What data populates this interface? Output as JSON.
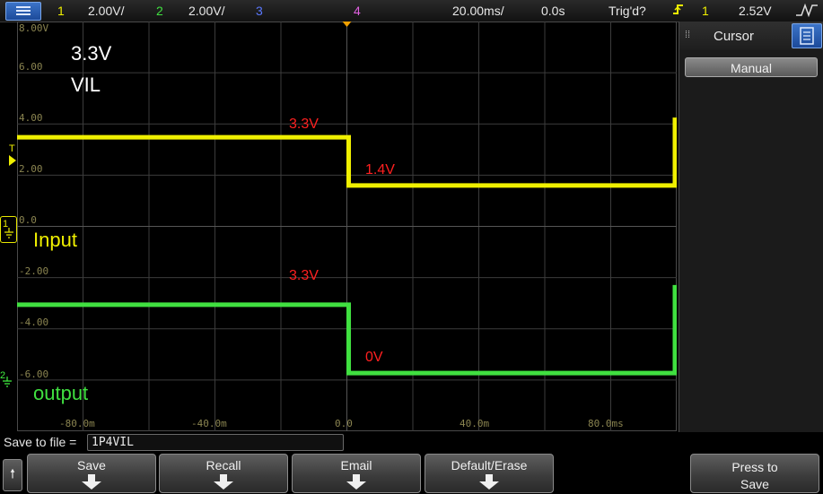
{
  "status_bar": {
    "ch1_label": "1",
    "ch1_scale": "2.00V/",
    "ch2_label": "2",
    "ch2_scale": "2.00V/",
    "ch3_label": "3",
    "ch4_label": "4",
    "timebase": "20.00ms/",
    "delay": "0.0s",
    "trigger_state": "Trig'd?",
    "trigger_source": "1",
    "trigger_level": "2.52V",
    "colors": {
      "ch1": "#f0f000",
      "ch2": "#40e040",
      "ch3": "#5a78ff",
      "ch4": "#e060e0",
      "menu": "#2a60b8"
    }
  },
  "graticule": {
    "y_labels": [
      "8.00V",
      "6.00",
      "4.00",
      "2.00",
      "0.0",
      "-2.00",
      "-4.00",
      "-6.00"
    ],
    "x_labels": [
      "-80.0m",
      "-40.0m",
      "0.0",
      "40.0m",
      "80.0ms"
    ]
  },
  "annotations": {
    "title_line1": "3.3V",
    "title_line2": "VIL",
    "input_label": "Input",
    "output_label": "output",
    "ch1_high": "3.3V",
    "ch1_low": "1.4V",
    "ch2_high": "3.3V",
    "ch2_low": "0V"
  },
  "waveforms": {
    "ch1": {
      "before_trigger_V": 3.3,
      "after_trigger_V": 1.4,
      "color": "#f0f000"
    },
    "ch2": {
      "before_trigger_V": -3.3,
      "after_trigger_V": -6.0,
      "color": "#40e040"
    }
  },
  "markers": {
    "ch1": "1",
    "ch2": "2",
    "trigger_level": "T"
  },
  "side_panel": {
    "title": "Cursor",
    "mode_button": "Manual"
  },
  "save_bar": {
    "label": "Save to file =",
    "filename": "1P4VIL"
  },
  "softkeys": {
    "save": "Save",
    "recall": "Recall",
    "email": "Email",
    "default_erase": "Default/Erase",
    "press_to_save_line1": "Press to",
    "press_to_save_line2": "Save"
  }
}
